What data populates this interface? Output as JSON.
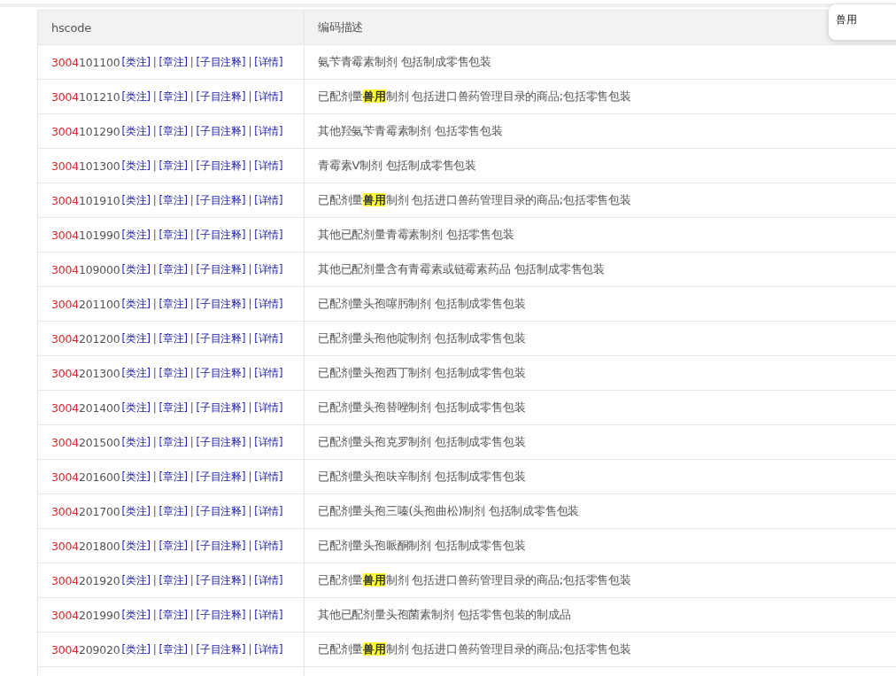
{
  "search_popup": {
    "text": "兽用"
  },
  "table": {
    "columns": [
      "hscode",
      "编码描述"
    ],
    "rows": [
      {
        "code_prefix": "3004",
        "code_rest": "101100",
        "links": [
          "[类注]",
          "[章注]",
          "[子目注释]",
          "[详情]"
        ],
        "separator": "|",
        "description": "氨苄青霉素制剂 包括制成零售包装"
      },
      {
        "code_prefix": "3004",
        "code_rest": "101210",
        "links": [
          "[类注]",
          "[章注]",
          "[子目注释]",
          "[详情]"
        ],
        "separator": "|",
        "description": "已配剂量**兽用**制剂 包括进口兽药管理目录的商品;包括零售包装"
      },
      {
        "code_prefix": "3004",
        "code_rest": "101290",
        "links": [
          "[类注]",
          "[章注]",
          "[子目注释]",
          "[详情]"
        ],
        "separator": "|",
        "description": "其他羟氨苄青霉素制剂 包括零售包装"
      },
      {
        "code_prefix": "3004",
        "code_rest": "101300",
        "links": [
          "[类注]",
          "[章注]",
          "[子目注释]",
          "[详情]"
        ],
        "separator": "|",
        "description": "青霉素V制剂 包括制成零售包装"
      },
      {
        "code_prefix": "3004",
        "code_rest": "101910",
        "links": [
          "[类注]",
          "[章注]",
          "[子目注释]",
          "[详情]"
        ],
        "separator": "|",
        "description": "已配剂量**兽用**制剂 包括进口兽药管理目录的商品;包括零售包装"
      },
      {
        "code_prefix": "3004",
        "code_rest": "101990",
        "links": [
          "[类注]",
          "[章注]",
          "[子目注释]",
          "[详情]"
        ],
        "separator": "|",
        "description": "其他已配剂量青霉素制剂 包括零售包装"
      },
      {
        "code_prefix": "3004",
        "code_rest": "109000",
        "links": [
          "[类注]",
          "[章注]",
          "[子目注释]",
          "[详情]"
        ],
        "separator": "|",
        "description": "其他已配剂量含有青霉素或链霉素药品 包括制成零售包装"
      },
      {
        "code_prefix": "3004",
        "code_rest": "201100",
        "links": [
          "[类注]",
          "[章注]",
          "[子目注释]",
          "[详情]"
        ],
        "separator": "|",
        "description": "已配剂量头孢噻肟制剂 包括制成零售包装"
      },
      {
        "code_prefix": "3004",
        "code_rest": "201200",
        "links": [
          "[类注]",
          "[章注]",
          "[子目注释]",
          "[详情]"
        ],
        "separator": "|",
        "description": "已配剂量头孢他啶制剂 包括制成零售包装"
      },
      {
        "code_prefix": "3004",
        "code_rest": "201300",
        "links": [
          "[类注]",
          "[章注]",
          "[子目注释]",
          "[详情]"
        ],
        "separator": "|",
        "description": "已配剂量头孢西丁制剂 包括制成零售包装"
      },
      {
        "code_prefix": "3004",
        "code_rest": "201400",
        "links": [
          "[类注]",
          "[章注]",
          "[子目注释]",
          "[详情]"
        ],
        "separator": "|",
        "description": "已配剂量头孢替唑制剂 包括制成零售包装"
      },
      {
        "code_prefix": "3004",
        "code_rest": "201500",
        "links": [
          "[类注]",
          "[章注]",
          "[子目注释]",
          "[详情]"
        ],
        "separator": "|",
        "description": "已配剂量头孢克罗制剂 包括制成零售包装"
      },
      {
        "code_prefix": "3004",
        "code_rest": "201600",
        "links": [
          "[类注]",
          "[章注]",
          "[子目注释]",
          "[详情]"
        ],
        "separator": "|",
        "description": "已配剂量头孢呋辛制剂 包括制成零售包装"
      },
      {
        "code_prefix": "3004",
        "code_rest": "201700",
        "links": [
          "[类注]",
          "[章注]",
          "[子目注释]",
          "[详情]"
        ],
        "separator": "|",
        "description": "已配剂量头孢三嗪(头孢曲松)制剂 包括制成零售包装"
      },
      {
        "code_prefix": "3004",
        "code_rest": "201800",
        "links": [
          "[类注]",
          "[章注]",
          "[子目注释]",
          "[详情]"
        ],
        "separator": "|",
        "description": "已配剂量头孢哌酮制剂 包括制成零售包装"
      },
      {
        "code_prefix": "3004",
        "code_rest": "201920",
        "links": [
          "[类注]",
          "[章注]",
          "[子目注释]",
          "[详情]"
        ],
        "separator": "|",
        "description": "已配剂量**兽用**制剂 包括进口兽药管理目录的商品;包括零售包装"
      },
      {
        "code_prefix": "3004",
        "code_rest": "201990",
        "links": [
          "[类注]",
          "[章注]",
          "[子目注释]",
          "[详情]"
        ],
        "separator": "|",
        "description": "其他已配剂量头孢菌素制剂 包括零售包装的制成品"
      },
      {
        "code_prefix": "3004",
        "code_rest": "209020",
        "links": [
          "[类注]",
          "[章注]",
          "[子目注释]",
          "[详情]"
        ],
        "separator": "|",
        "description": "已配剂量**兽用**制剂 包括进口兽药管理目录的商品;包括零售包装"
      }
    ]
  }
}
